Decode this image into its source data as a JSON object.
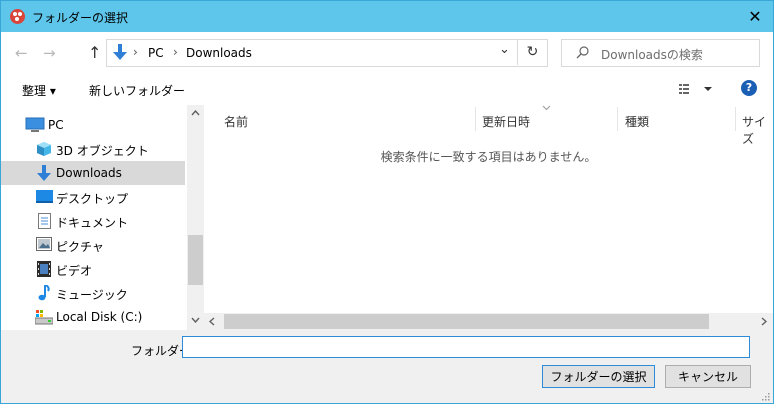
{
  "window": {
    "title": "フォルダーの選択",
    "close_glyph": "✕"
  },
  "navigation": {
    "back_glyph": "←",
    "forward_glyph": "→",
    "up_glyph": "↑",
    "breadcrumb": [
      "PC",
      "Downloads"
    ],
    "breadcrumb_sep": "›",
    "dropdown_glyph": "⌄",
    "refresh_glyph": "↻",
    "search_placeholder": "Downloadsの検索"
  },
  "toolbar": {
    "organize_label": "整理 ▾",
    "new_folder_label": "新しいフォルダー",
    "help_glyph": "?"
  },
  "nav_pane": {
    "items": [
      {
        "label": "PC",
        "icon": "pc-icon"
      },
      {
        "label": "3D オブジェクト",
        "icon": "3d-objects-icon"
      },
      {
        "label": "Downloads",
        "icon": "downloads-icon",
        "selected": true
      },
      {
        "label": "デスクトップ",
        "icon": "desktop-icon"
      },
      {
        "label": "ドキュメント",
        "icon": "documents-icon"
      },
      {
        "label": "ピクチャ",
        "icon": "pictures-icon"
      },
      {
        "label": "ビデオ",
        "icon": "videos-icon"
      },
      {
        "label": "ミュージック",
        "icon": "music-icon"
      },
      {
        "label": "Local Disk (C:)",
        "icon": "local-disk-icon"
      }
    ]
  },
  "file_list": {
    "columns": [
      "名前",
      "更新日時",
      "種類",
      "サイズ"
    ],
    "empty_message": "検索条件に一致する項目はありません。"
  },
  "footer": {
    "folder_label": "フォルダー:",
    "folder_value": "",
    "select_button": "フォルダーの選択",
    "cancel_button": "キャンセル"
  },
  "colors": {
    "titlebar": "#5ec6ea",
    "selection": "#d9d9d9",
    "accent": "#2e8bd8"
  }
}
